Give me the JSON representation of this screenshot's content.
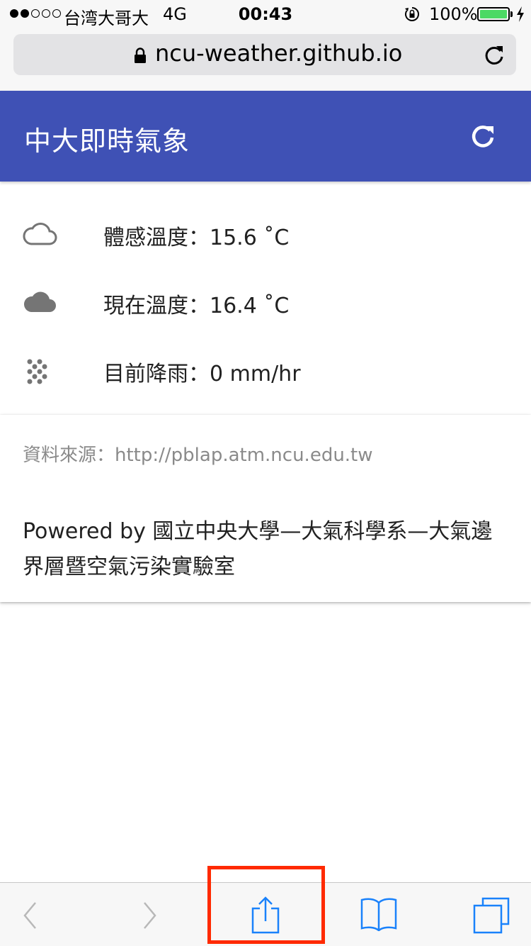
{
  "status_bar": {
    "carrier": "台湾大哥大",
    "network": "4G",
    "time": "00:43",
    "battery": "100%",
    "battery_level": 1.0
  },
  "browser": {
    "url": "ncu-weather.github.io"
  },
  "app": {
    "title": "中大即時氣象",
    "accent_color": "#3f51b5"
  },
  "weather": {
    "items": [
      {
        "icon": "cloud-outline-icon",
        "text": "體感溫度：15.6 ˚C"
      },
      {
        "icon": "cloud-filled-icon",
        "text": "現在溫度：16.4 ˚C"
      },
      {
        "icon": "rain-dots-icon",
        "text": "目前降雨：0 mm/hr"
      }
    ]
  },
  "card": {
    "source": "資料來源：http://pblap.atm.ncu.edu.tw",
    "powered_by": "Powered by 國立中央大學—大氣科學系—大氣邊界層暨空氣污染實驗室"
  },
  "toolbar": {
    "highlight_color": "#ff2a00",
    "buttons": [
      "back-icon",
      "forward-icon",
      "share-icon",
      "bookmarks-icon",
      "tabs-icon"
    ]
  }
}
